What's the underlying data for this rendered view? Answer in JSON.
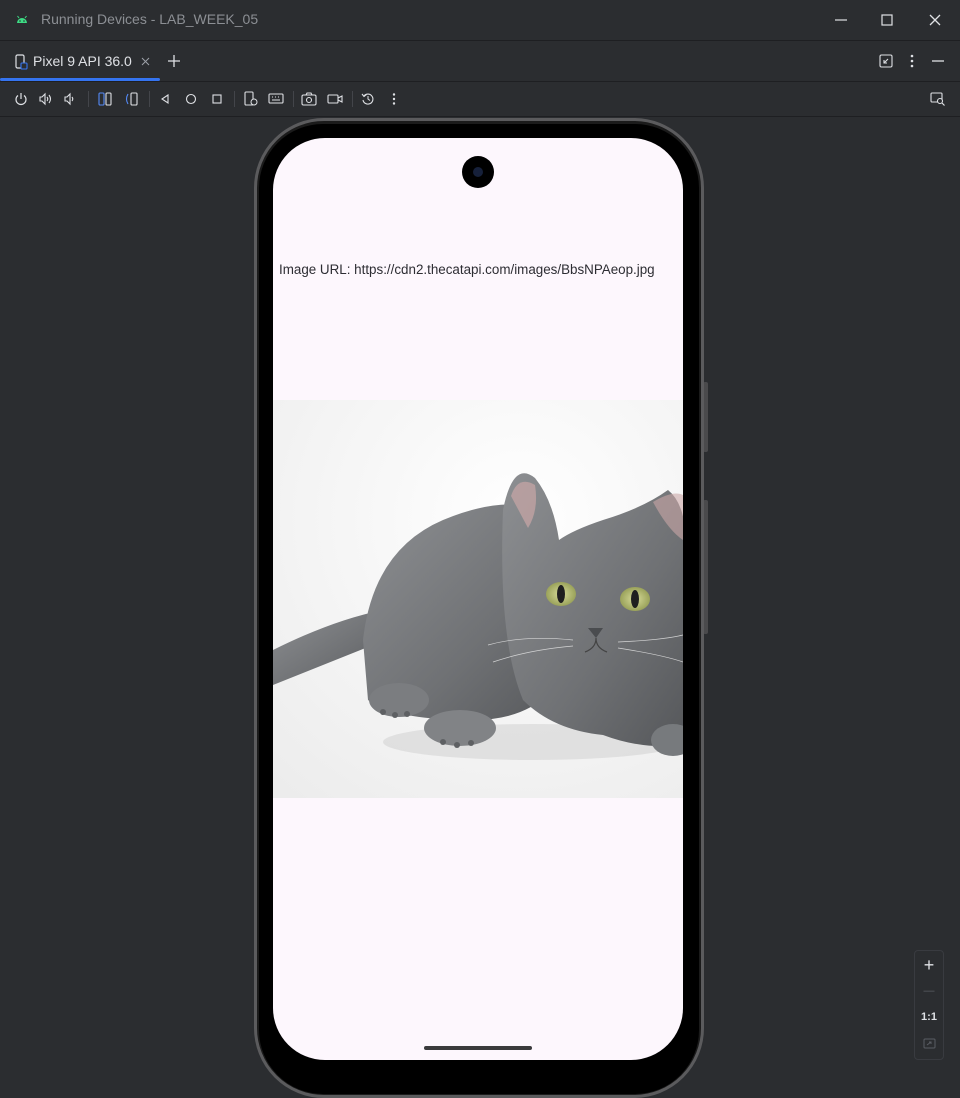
{
  "window": {
    "title": "Running Devices - LAB_WEEK_05",
    "app_icon": "android-icon",
    "controls": [
      "minimize-icon",
      "maximize-icon",
      "close-icon"
    ]
  },
  "tabs": [
    {
      "label": "Pixel 9 API 36.0",
      "icon": "device-icon",
      "active": true
    }
  ],
  "tabbar_actions": [
    "add-tab-icon",
    "restore-layout-icon",
    "more-vert-icon",
    "hide-panel-icon"
  ],
  "toolbar": {
    "buttons": [
      "power-icon",
      "volume-up-icon",
      "volume-down-icon",
      "rotate-left-icon",
      "rotate-right-icon",
      "back-icon",
      "home-icon",
      "overview-icon",
      "device-settings-icon",
      "keyboard-icon",
      "screenshot-icon",
      "screen-record-icon",
      "reset-icon",
      "more-vert-icon"
    ],
    "right_button": "zoom-inspect-icon"
  },
  "device_screen": {
    "url_label": "Image URL: https://cdn2.thecatapi.com/images/BbsNPAeop.jpg",
    "image": "gray cat photo",
    "background": "#fdf7fd"
  },
  "zoom_controls": {
    "zoom_in": "+",
    "zoom_out": "—",
    "actual_size": "1:1",
    "fit": "fit-screen-icon"
  },
  "colors": {
    "ide_background": "#2b2d30",
    "accent": "#3574f0",
    "android_green": "#3ddc84"
  }
}
